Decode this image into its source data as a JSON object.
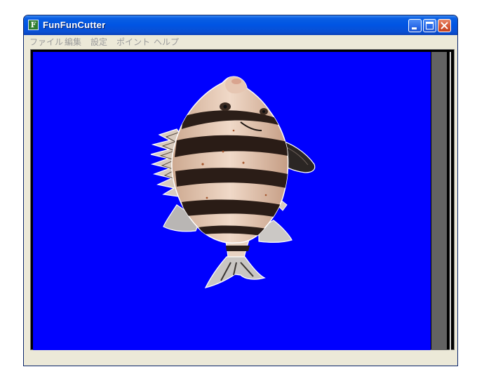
{
  "window": {
    "title": "FunFunCutter",
    "icon_letter": "F",
    "icon": "app-icon",
    "controls": {
      "minimize": "minimize-icon",
      "maximize": "maximize-icon",
      "close": "close-icon"
    }
  },
  "menubar": {
    "items": [
      {
        "label": "ファイル"
      },
      {
        "label": "編集"
      },
      {
        "label": "設定"
      },
      {
        "label": "ポイント"
      },
      {
        "label": "ヘルプ"
      }
    ]
  },
  "canvas": {
    "background_color": "#0000ff",
    "content": "fish-image"
  },
  "statusbar": {
    "text": ""
  },
  "colors": {
    "titlebar": "#0054e3",
    "window_bg": "#ece9d8",
    "scrollbar": "#626262",
    "menu_text_disabled": "#9a9a9a"
  }
}
